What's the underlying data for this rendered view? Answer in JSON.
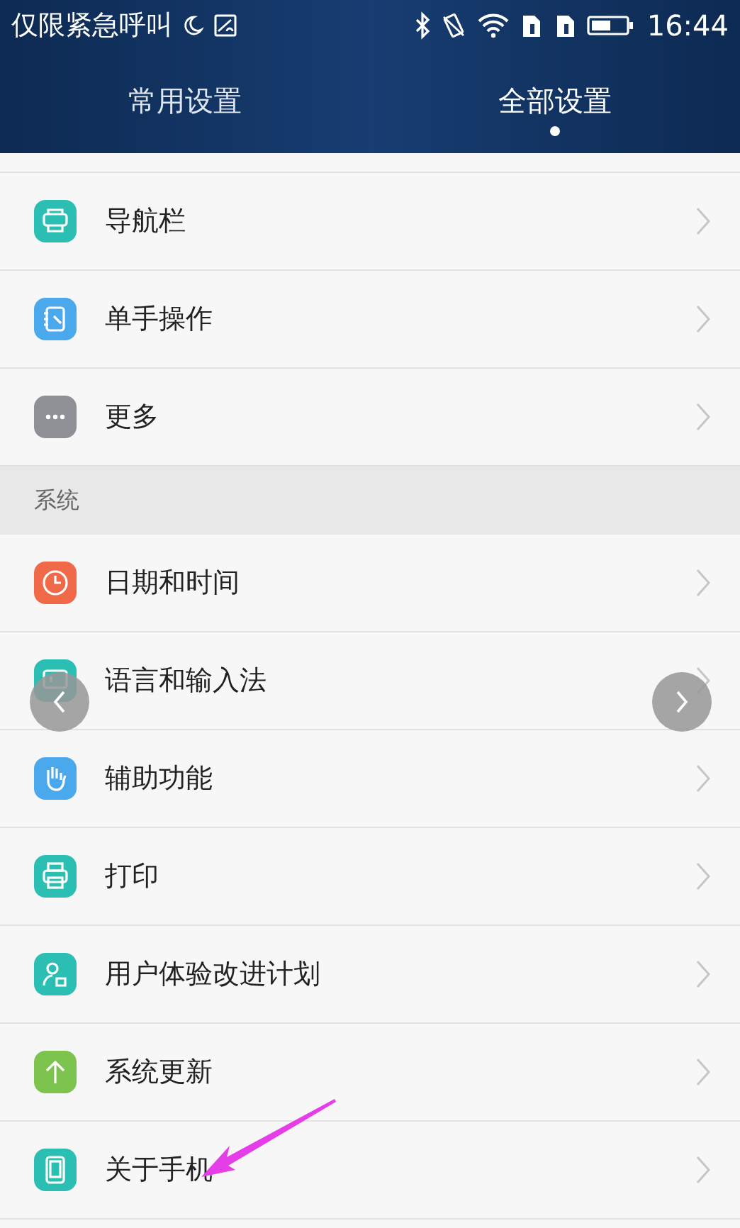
{
  "status_bar": {
    "carrier": "仅限紧急呼叫",
    "time": "16:44"
  },
  "tabs": [
    {
      "label": "常用设置",
      "selected": false
    },
    {
      "label": "全部设置",
      "selected": true
    }
  ],
  "rows": [
    {
      "kind": "item",
      "label": "导航栏",
      "color": "#2bbfb3"
    },
    {
      "kind": "item",
      "label": "单手操作",
      "color": "#4aa8ec"
    },
    {
      "kind": "item",
      "label": "更多",
      "color": "#8e9096"
    },
    {
      "kind": "section",
      "label": "系统"
    },
    {
      "kind": "item",
      "label": "日期和时间",
      "color": "#f06a4a"
    },
    {
      "kind": "item",
      "label": "语言和输入法",
      "color": "#2bbfb3"
    },
    {
      "kind": "item",
      "label": "辅助功能",
      "color": "#4aa8ec"
    },
    {
      "kind": "item",
      "label": "打印",
      "color": "#2bbfb3"
    },
    {
      "kind": "item",
      "label": "用户体验改进计划",
      "color": "#2bbfb3"
    },
    {
      "kind": "item",
      "label": "系统更新",
      "color": "#7cc44e"
    },
    {
      "kind": "item",
      "label": "关于手机",
      "color": "#2bbfb3"
    }
  ]
}
